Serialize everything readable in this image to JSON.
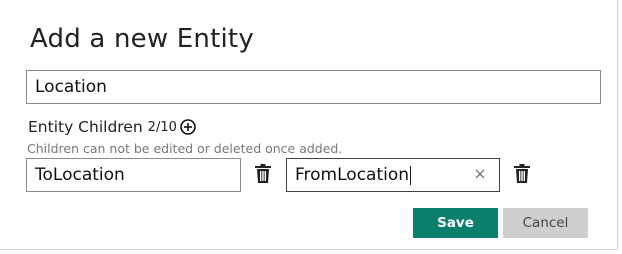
{
  "dialog": {
    "title": "Add a new Entity"
  },
  "entity_name": {
    "value": "Location"
  },
  "children": {
    "label": "Entity Children",
    "count": "2/10",
    "hint": "Children can not be edited or deleted once added.",
    "items": [
      {
        "value": "ToLocation"
      },
      {
        "value": "FromLocation"
      }
    ]
  },
  "buttons": {
    "save_label": "Save",
    "cancel_label": "Cancel"
  },
  "colors": {
    "accent": "#0b7f6e",
    "cancel_bg": "#cfcfcf"
  },
  "icons": {
    "add_child": "circle-plus-icon",
    "delete": "trash-icon",
    "clear": "close-icon"
  }
}
